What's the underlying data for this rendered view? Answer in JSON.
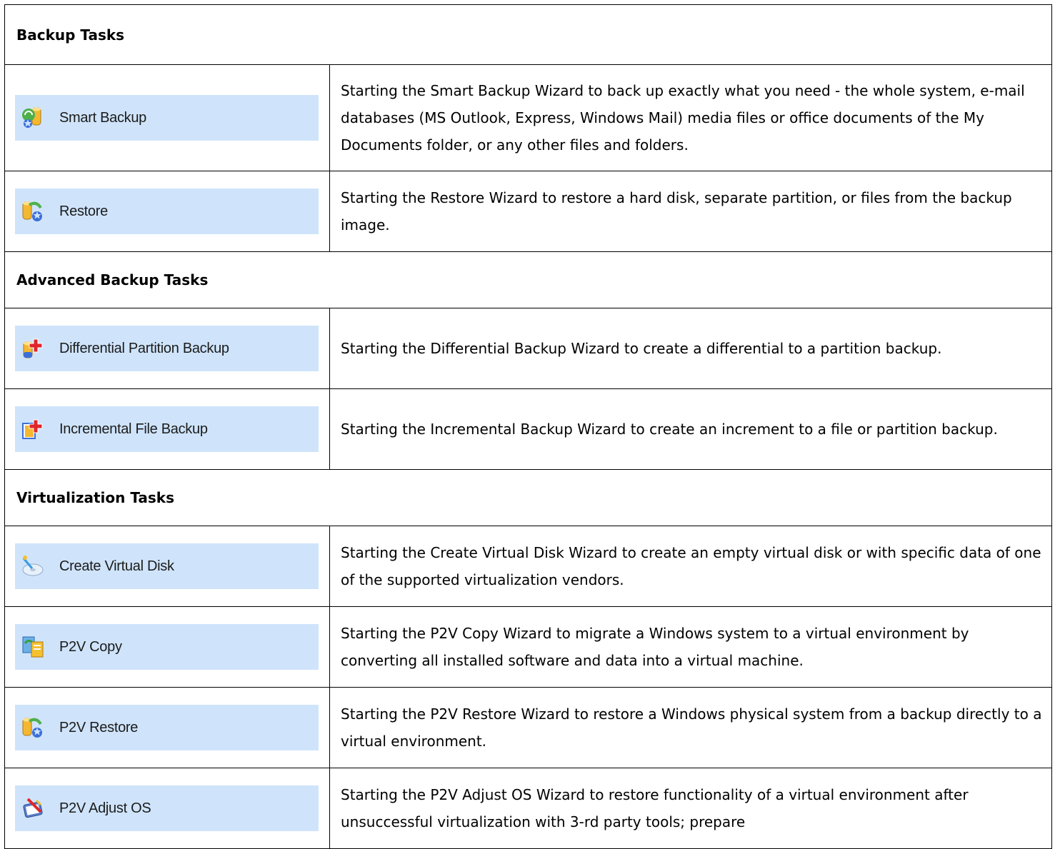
{
  "sections": [
    {
      "title": "Backup Tasks",
      "rows": [
        {
          "button": "Smart Backup",
          "icon": "smart-backup-icon",
          "description": "Starting the Smart Backup Wizard to back up exactly what you need - the whole system, e-mail databases (MS Outlook, Express, Windows Mail) media files or office documents of the My Documents folder, or any other files and folders."
        },
        {
          "button": "Restore",
          "icon": "restore-icon",
          "description": "Starting the Restore Wizard to restore a hard disk, separate partition, or files from the backup image."
        }
      ]
    },
    {
      "title": "Advanced Backup Tasks",
      "rows": [
        {
          "button": "Differential Partition Backup",
          "icon": "differential-backup-icon",
          "description": "Starting the Differential Backup Wizard to create a differential to a partition backup."
        },
        {
          "button": "Incremental File Backup",
          "icon": "incremental-backup-icon",
          "description": "Starting the Incremental Backup Wizard to create an increment to a file or partition backup."
        }
      ]
    },
    {
      "title": "Virtualization Tasks",
      "rows": [
        {
          "button": "Create Virtual Disk",
          "icon": "create-virtual-disk-icon",
          "description": "Starting the Create Virtual Disk Wizard to create an empty virtual disk or with specific data of one of the supported virtualization vendors."
        },
        {
          "button": "P2V Copy",
          "icon": "p2v-copy-icon",
          "description": "Starting the P2V Copy Wizard to migrate a Windows system to a virtual environment by converting all installed software and data into a virtual machine."
        },
        {
          "button": "P2V Restore",
          "icon": "p2v-restore-icon",
          "description": "Starting the P2V Restore Wizard to restore a Windows physical system from a backup directly to a virtual environment."
        },
        {
          "button": "P2V Adjust OS",
          "icon": "p2v-adjust-os-icon",
          "description": "Starting the P2V Adjust OS Wizard to restore functionality of a virtual environment after unsuccessful virtualization with 3-rd party tools; prepare"
        }
      ]
    }
  ],
  "colors": {
    "button_bg": "#cfe4fb",
    "border": "#000000"
  }
}
